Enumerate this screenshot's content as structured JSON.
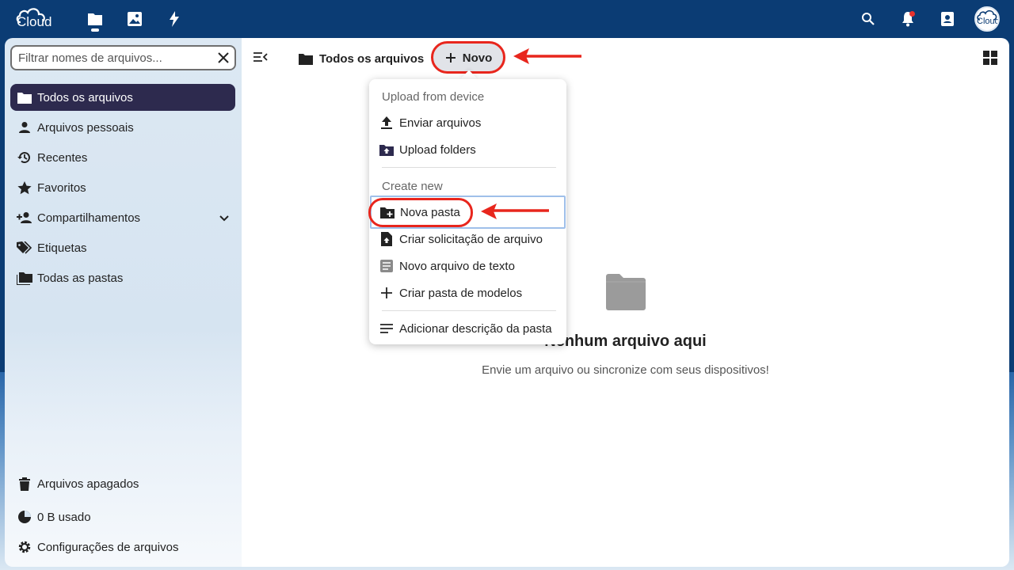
{
  "header": {
    "logo_text": "Cloud",
    "avatar_text": "Cloud",
    "apps": [
      "files-icon",
      "photos-icon",
      "activity-icon"
    ],
    "right_icons": [
      "search-icon",
      "bell-icon",
      "contacts-icon"
    ]
  },
  "sidebar": {
    "filter_placeholder": "Filtrar nomes de arquivos...",
    "items": [
      {
        "label": "Todos os arquivos",
        "icon": "folder-icon"
      },
      {
        "label": "Arquivos pessoais",
        "icon": "person-icon"
      },
      {
        "label": "Recentes",
        "icon": "history-icon"
      },
      {
        "label": "Favoritos",
        "icon": "star-icon"
      },
      {
        "label": "Compartilhamentos",
        "icon": "share-icon"
      },
      {
        "label": "Etiquetas",
        "icon": "tag-icon"
      },
      {
        "label": "Todas as pastas",
        "icon": "folders-icon"
      }
    ],
    "footer": [
      {
        "label": "Arquivos apagados",
        "icon": "trash-icon"
      },
      {
        "label": "0 B usado",
        "icon": "pie-icon"
      },
      {
        "label": "Configurações de arquivos",
        "icon": "gear-icon"
      }
    ]
  },
  "main": {
    "breadcrumb": "Todos os arquivos",
    "new_button": "Novo",
    "empty_title": "Nenhum arquivo aqui",
    "empty_subtitle": "Envie um arquivo ou sincronize com seus dispositivos!"
  },
  "menu": {
    "caption_upload": "Upload from device",
    "caption_create": "Create new",
    "items": [
      {
        "label": "Enviar arquivos",
        "icon": "upload-icon"
      },
      {
        "label": "Upload folders",
        "icon": "folder-upload-icon"
      },
      {
        "label": "Nova pasta",
        "icon": "folder-plus-icon"
      },
      {
        "label": "Criar solicitação de arquivo",
        "icon": "file-request-icon"
      },
      {
        "label": "Novo arquivo de texto",
        "icon": "text-file-icon"
      },
      {
        "label": "Criar pasta de modelos",
        "icon": "plus-icon"
      },
      {
        "label": "Adicionar descrição da pasta",
        "icon": "description-icon"
      }
    ]
  },
  "colors": {
    "header_bg": "#0b3c74",
    "active_nav": "#2d2a4e",
    "annotation_red": "#e8261d"
  }
}
